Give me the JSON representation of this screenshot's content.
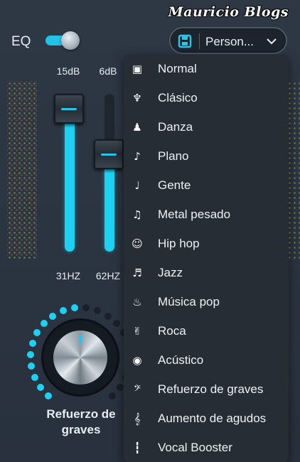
{
  "watermark": "Mauricio Blogs",
  "eq": {
    "label": "EQ",
    "enabled": true
  },
  "preset_selector": {
    "value": "Person...",
    "icon": "save-icon"
  },
  "bands": [
    {
      "db": "15dB",
      "freq": "31HZ",
      "level": 0.91
    },
    {
      "db": "6dB",
      "freq": "62HZ",
      "level": 0.62
    }
  ],
  "bass_boost": {
    "label_line1": "Refuerzo de",
    "label_line2": "graves"
  },
  "menu": {
    "items": [
      {
        "label": "Normal",
        "icon": "speaker-icon"
      },
      {
        "label": "Clásico",
        "icon": "harp-icon"
      },
      {
        "label": "Danza",
        "icon": "dancer-icon"
      },
      {
        "label": "Plano",
        "icon": "piano-icon"
      },
      {
        "label": "Gente",
        "icon": "folk-guitar-icon"
      },
      {
        "label": "Metal pesado",
        "icon": "electric-guitar-icon"
      },
      {
        "label": "Hip hop",
        "icon": "hip-hop-icon"
      },
      {
        "label": "Jazz",
        "icon": "trumpet-icon"
      },
      {
        "label": "Música pop",
        "icon": "flame-icon"
      },
      {
        "label": "Roca",
        "icon": "rock-hand-icon"
      },
      {
        "label": "Acústico",
        "icon": "vinyl-icon"
      },
      {
        "label": "Refuerzo de graves",
        "icon": "bass-clef-icon"
      },
      {
        "label": "Aumento de agudos",
        "icon": "treble-clef-icon"
      },
      {
        "label": "Vocal Booster",
        "icon": "waveform-icon"
      }
    ]
  },
  "colors": {
    "accent": "#1ed1f3",
    "background": "#2b3440",
    "menu": "#262d35"
  }
}
